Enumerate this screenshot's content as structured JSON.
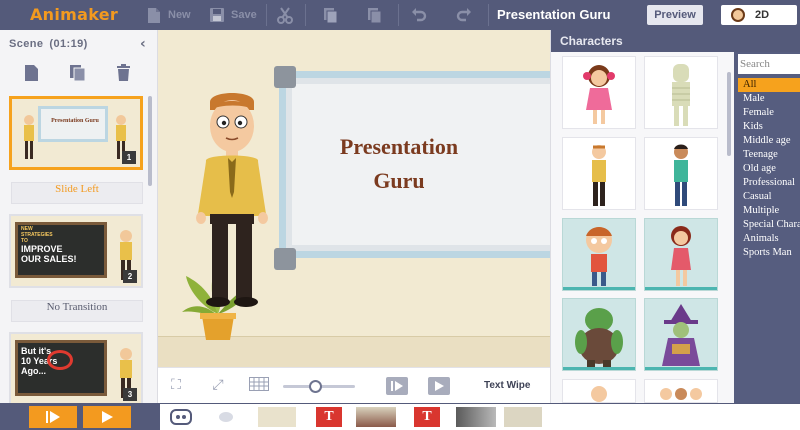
{
  "app": {
    "logo": "Animaker",
    "project_title": "Presentation Guru",
    "preview_label": "Preview",
    "mode_label": "2D"
  },
  "toolbar": {
    "new_label": "New",
    "save_label": "Save"
  },
  "scene_panel": {
    "title": "Scene",
    "duration": "(01:19)",
    "scenes": [
      {
        "thumb_title": "Presentation Guru",
        "number": "1",
        "transition": "Slide Left"
      },
      {
        "thumb_lines": [
          "NEW",
          "STRATEGIES",
          "TO",
          "IMPROVE",
          "OUR SALES!"
        ],
        "number": "2",
        "transition": "No Transition"
      },
      {
        "thumb_lines": [
          "But it's",
          "10 Years",
          "Ago..."
        ],
        "number": "3"
      }
    ]
  },
  "stage": {
    "board_title_line1": "Presentation",
    "board_title_line2": "Guru",
    "transition_label": "Text Wipe",
    "zoom_level": 0.45
  },
  "characters": {
    "title": "Characters",
    "search_placeholder": "Search",
    "categories": [
      "All",
      "Male",
      "Female",
      "Kids",
      "Middle age",
      "Teenage",
      "Old age",
      "Professional",
      "Casual",
      "Multiple",
      "Special Characters",
      "Animals",
      "Sports Man"
    ],
    "selected_category": "All"
  },
  "colors": {
    "accent": "#f39a1f",
    "toolbar_bg": "#545a7a",
    "board_text": "#7b3b1f",
    "highlight_teal": "#4cb5b0"
  }
}
